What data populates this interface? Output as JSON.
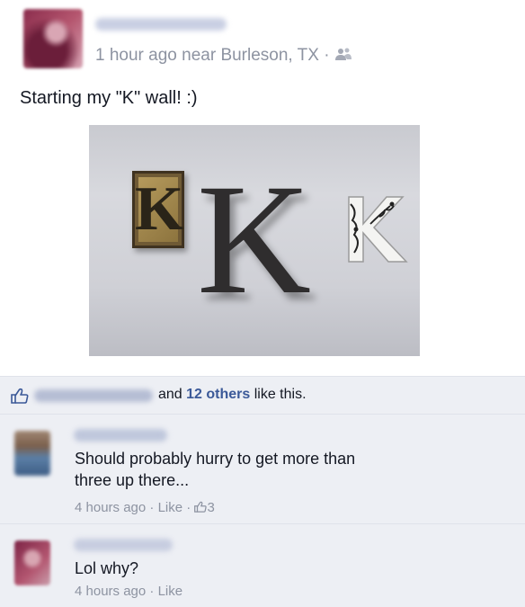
{
  "post": {
    "meta": "1 hour ago near Burleson, TX ·",
    "text": "Starting my \"K\" wall! :)",
    "photo": {
      "framed_letter": "K",
      "big_letter": "K"
    }
  },
  "likes": {
    "and": "and ",
    "others": "12 others",
    "suffix": " like this."
  },
  "comments": [
    {
      "text": "Should probably hurry to get more than three up there...",
      "time": "4 hours ago",
      "sep": " · ",
      "like_label": "Like",
      "like_count": "3"
    },
    {
      "text": "Lol why?",
      "time": "4 hours ago",
      "sep": " · ",
      "like_label": "Like"
    }
  ],
  "colors": {
    "link": "#3b5998",
    "meta": "#8d93a1",
    "comment_bg": "#edeff4"
  },
  "icons": [
    "friends-icon",
    "like-thumb-icon"
  ]
}
